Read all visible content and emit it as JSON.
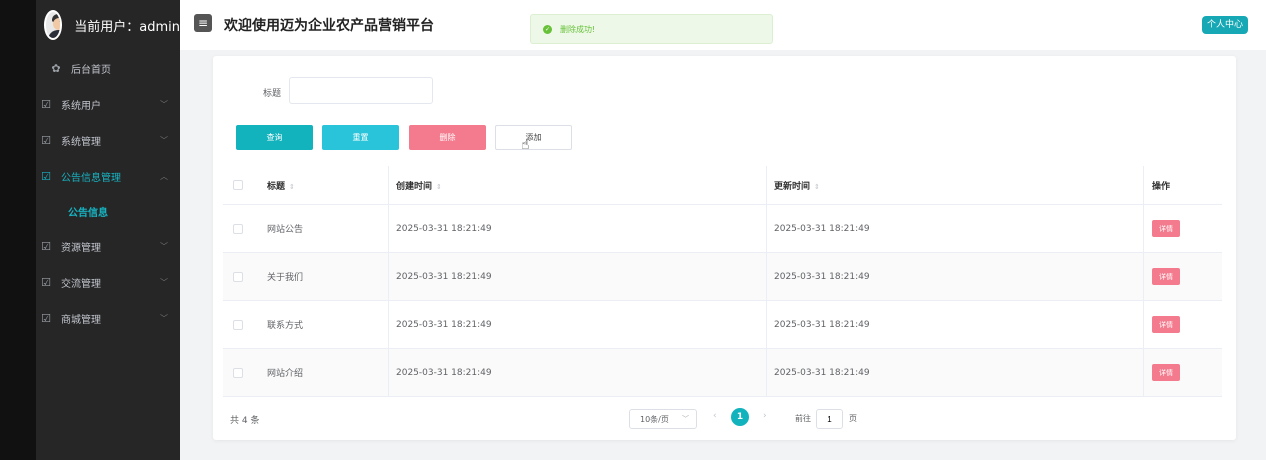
{
  "colors": {
    "accent": "#12b3bd",
    "danger": "#f47b8e",
    "success": "#67c23a",
    "sidebar": "#262626"
  },
  "header": {
    "current_user": "当前用户：admin",
    "app_title": "欢迎使用迈为企业农产品营销平台",
    "toast": "删除成功!",
    "profile_button": "个人中心"
  },
  "sidebar": {
    "items": [
      {
        "label": "后台首页",
        "icon": "home-icon"
      },
      {
        "label": "系统用户",
        "icon": "edit-icon"
      },
      {
        "label": "系统管理",
        "icon": "edit-icon"
      },
      {
        "label": "公告信息管理",
        "icon": "edit-icon"
      },
      {
        "label": "公告信息",
        "icon": ""
      },
      {
        "label": "资源管理",
        "icon": "edit-icon"
      },
      {
        "label": "交流管理",
        "icon": "edit-icon"
      },
      {
        "label": "商城管理",
        "icon": "edit-icon"
      }
    ]
  },
  "search": {
    "label": "标题",
    "value": "",
    "placeholder": ""
  },
  "buttons": {
    "query": "查询",
    "reset": "重置",
    "delete": "删除",
    "add": "添加"
  },
  "table": {
    "headers": {
      "title": "标题",
      "created": "创建时间",
      "updated": "更新时间",
      "action": "操作"
    },
    "rows": [
      {
        "title": "网站公告",
        "created": "2025-03-31 18:21:49",
        "updated": "2025-03-31 18:21:49",
        "action": "详情"
      },
      {
        "title": "关于我们",
        "created": "2025-03-31 18:21:49",
        "updated": "2025-03-31 18:21:49",
        "action": "详情"
      },
      {
        "title": "联系方式",
        "created": "2025-03-31 18:21:49",
        "updated": "2025-03-31 18:21:49",
        "action": "详情"
      },
      {
        "title": "网站介绍",
        "created": "2025-03-31 18:21:49",
        "updated": "2025-03-31 18:21:49",
        "action": "详情"
      }
    ]
  },
  "pagination": {
    "total": "共 4 条",
    "page_size": "10条/页",
    "current_page": "1",
    "goto_prefix": "前往",
    "goto_value": "1",
    "goto_suffix": "页"
  }
}
